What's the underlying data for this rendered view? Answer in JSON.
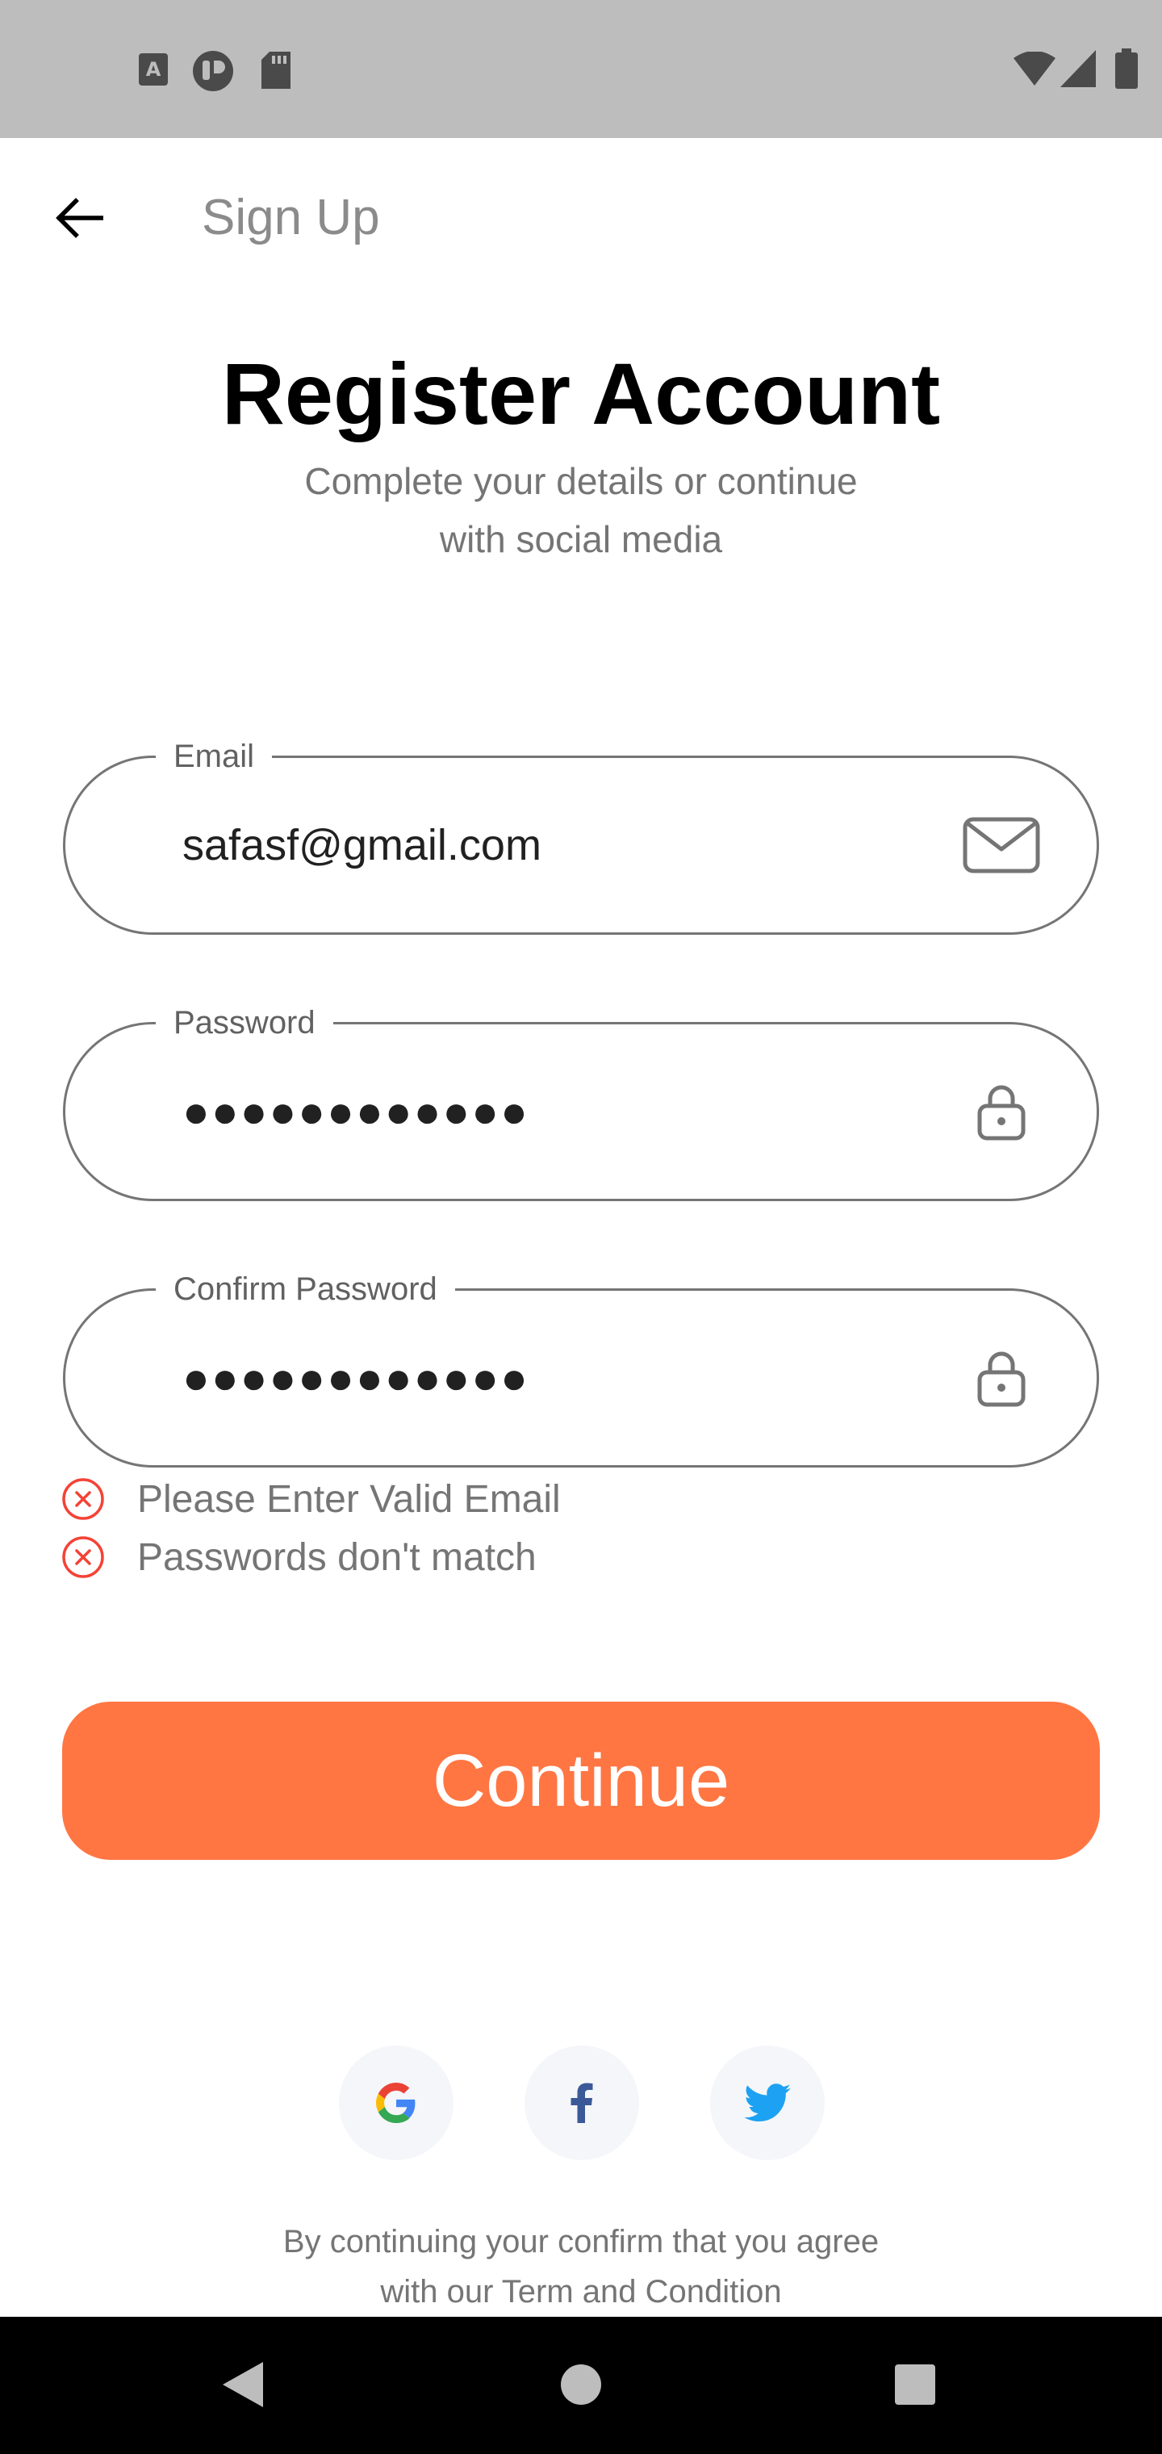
{
  "appbar": {
    "back_icon": "arrow-left-icon",
    "title": "Sign Up"
  },
  "header": {
    "title": "Register Account",
    "subtitle_line1": "Complete your details or continue",
    "subtitle_line2": "with social media"
  },
  "form": {
    "email": {
      "label": "Email",
      "value": "safasf@gmail.com",
      "icon": "mail-icon"
    },
    "password": {
      "label": "Password",
      "value": "●●●●●●●●●●●●",
      "icon": "lock-icon"
    },
    "confirm_password": {
      "label": "Confirm Password",
      "value": "●●●●●●●●●●●●",
      "icon": "lock-icon"
    },
    "errors": [
      "Please Enter Valid Email",
      "Passwords don't match"
    ],
    "continue_label": "Continue"
  },
  "social": [
    {
      "name": "google",
      "icon": "google-icon"
    },
    {
      "name": "facebook",
      "icon": "facebook-icon"
    },
    {
      "name": "twitter",
      "icon": "twitter-icon"
    }
  ],
  "terms": {
    "line1": "By continuing your confirm that you agree",
    "line2": "with our Term and Condition"
  },
  "colors": {
    "primary": "#FF7643",
    "error": "#F44336",
    "text_muted": "#757575",
    "social_bg": "#F5F6F9",
    "facebook": "#3B5998",
    "twitter": "#1DA1F2"
  }
}
